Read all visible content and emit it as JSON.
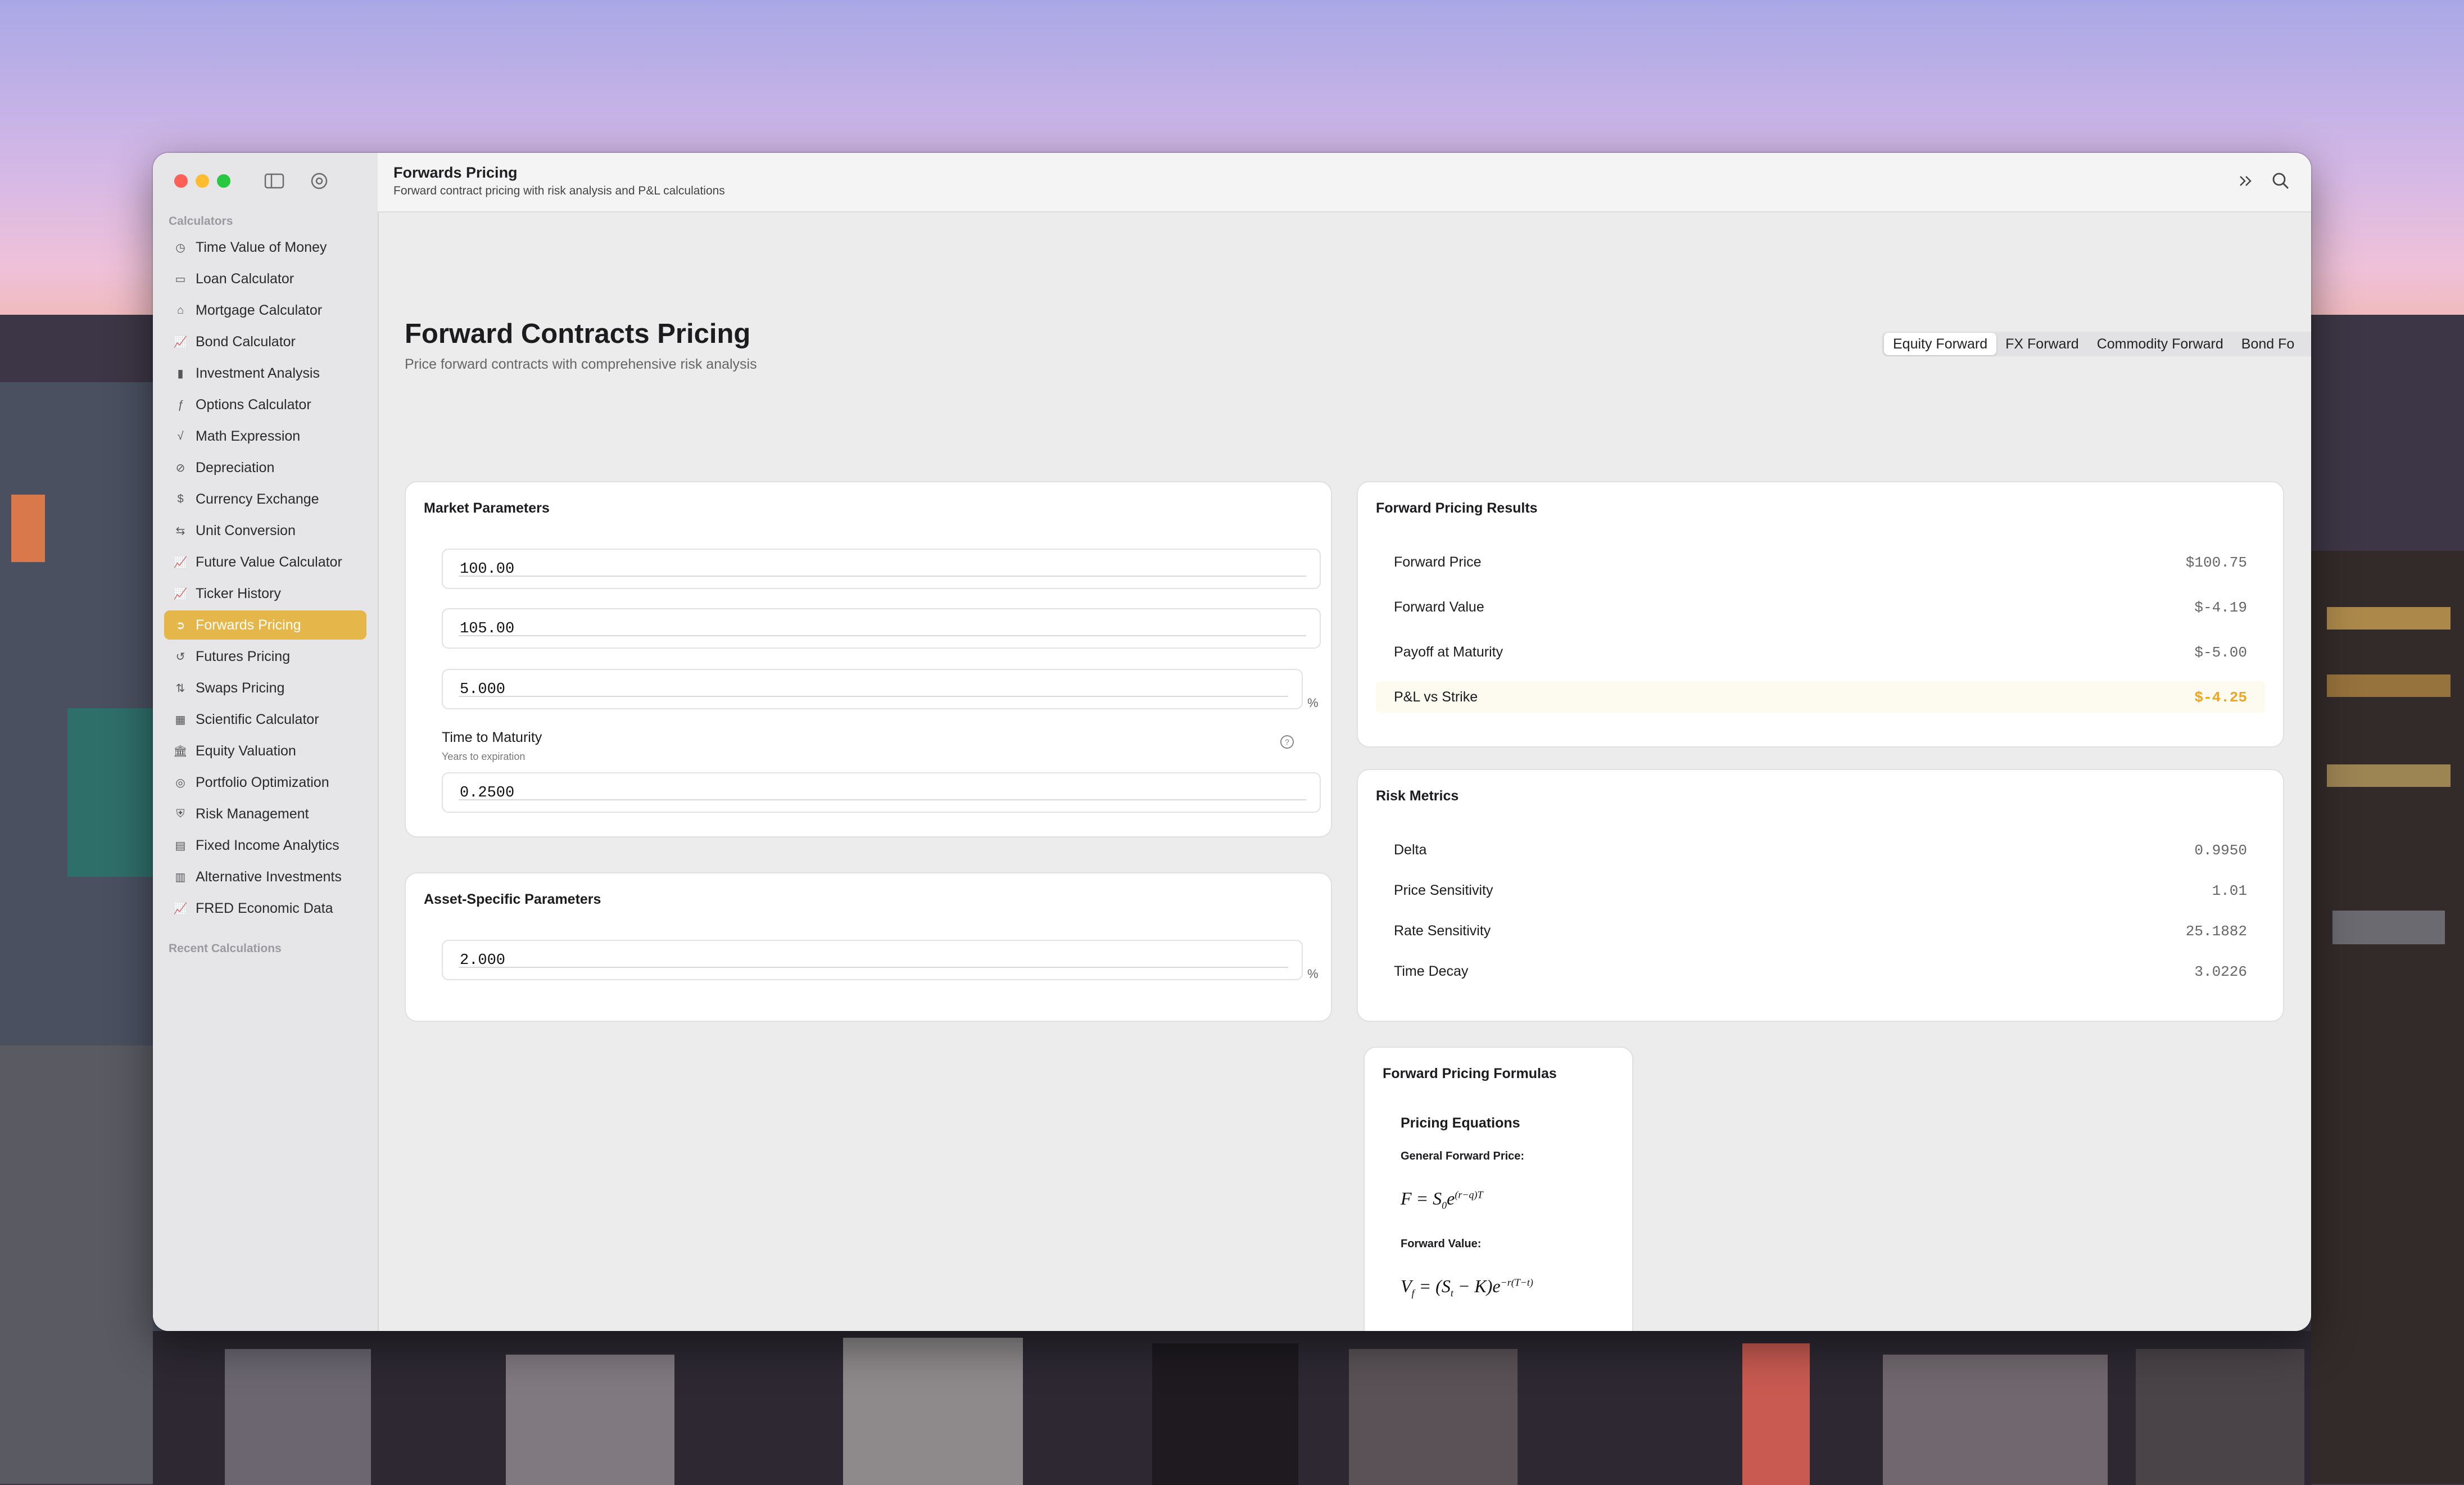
{
  "window": {
    "title": "Forwards Pricing",
    "subtitle": "Forward contract pricing with risk analysis and P&L calculations"
  },
  "sidebar": {
    "section_calculators": "Calculators",
    "section_recent": "Recent Calculations",
    "items": [
      {
        "label": "Time Value of Money",
        "icon": "clock-icon"
      },
      {
        "label": "Loan Calculator",
        "icon": "credit-card-icon"
      },
      {
        "label": "Mortgage Calculator",
        "icon": "house-icon"
      },
      {
        "label": "Bond Calculator",
        "icon": "chart-line-icon"
      },
      {
        "label": "Investment Analysis",
        "icon": "bar-chart-icon"
      },
      {
        "label": "Options Calculator",
        "icon": "function-icon"
      },
      {
        "label": "Math Expression",
        "icon": "sqrt-icon"
      },
      {
        "label": "Depreciation",
        "icon": "depreciation-icon"
      },
      {
        "label": "Currency Exchange",
        "icon": "dollar-circle-icon"
      },
      {
        "label": "Unit Conversion",
        "icon": "arrows-swap-icon"
      },
      {
        "label": "Future Value Calculator",
        "icon": "chart-line-icon"
      },
      {
        "label": "Ticker History",
        "icon": "chart-line-icon"
      },
      {
        "label": "Forwards Pricing",
        "icon": "arrow-circle-icon",
        "active": true
      },
      {
        "label": "Futures Pricing",
        "icon": "clock-arrow-icon"
      },
      {
        "label": "Swaps Pricing",
        "icon": "swap-vertical-icon"
      },
      {
        "label": "Scientific Calculator",
        "icon": "calculator-icon"
      },
      {
        "label": "Equity Valuation",
        "icon": "bank-icon"
      },
      {
        "label": "Portfolio Optimization",
        "icon": "target-icon"
      },
      {
        "label": "Risk Management",
        "icon": "shield-icon"
      },
      {
        "label": "Fixed Income Analytics",
        "icon": "document-icon"
      },
      {
        "label": "Alternative Investments",
        "icon": "building-icon"
      },
      {
        "label": "FRED Economic Data",
        "icon": "chart-line-icon"
      }
    ]
  },
  "main": {
    "title": "Forward Contracts Pricing",
    "subtitle": "Price forward contracts with comprehensive risk analysis",
    "tabs": [
      "Equity Forward",
      "FX Forward",
      "Commodity Forward",
      "Bond Fo"
    ],
    "selected_tab": "Equity Forward"
  },
  "market_params": {
    "title": "Market Parameters",
    "spot_value": "100.00",
    "strike_value": "105.00",
    "rate_value": "5.000",
    "rate_unit": "%",
    "ttm_label": "Time to Maturity",
    "ttm_sublabel": "Years to expiration",
    "ttm_value": "0.2500"
  },
  "asset_params": {
    "title": "Asset-Specific Parameters",
    "dividend_value": "2.000",
    "dividend_unit": "%"
  },
  "results": {
    "title": "Forward Pricing Results",
    "rows": [
      {
        "label": "Forward Price",
        "value": "$100.75"
      },
      {
        "label": "Forward Value",
        "value": "$-4.19"
      },
      {
        "label": "Payoff at Maturity",
        "value": "$-5.00"
      },
      {
        "label": "P&L vs Strike",
        "value": "$-4.25"
      }
    ],
    "highlight_color": "#f0a51c"
  },
  "risk": {
    "title": "Risk Metrics",
    "rows": [
      {
        "label": "Delta",
        "value": "0.9950"
      },
      {
        "label": "Price Sensitivity",
        "value": "1.01"
      },
      {
        "label": "Rate Sensitivity",
        "value": "25.1882"
      },
      {
        "label": "Time Decay",
        "value": "3.0226"
      }
    ]
  },
  "formulas": {
    "title": "Forward Pricing Formulas",
    "section": "Pricing Equations",
    "general_label": "General Forward Price:",
    "value_label": "Forward Value:"
  },
  "colors": {
    "accent": "#e5b64a",
    "traffic_red": "#fe5f57",
    "traffic_yellow": "#febc2e",
    "traffic_green": "#28c840"
  }
}
